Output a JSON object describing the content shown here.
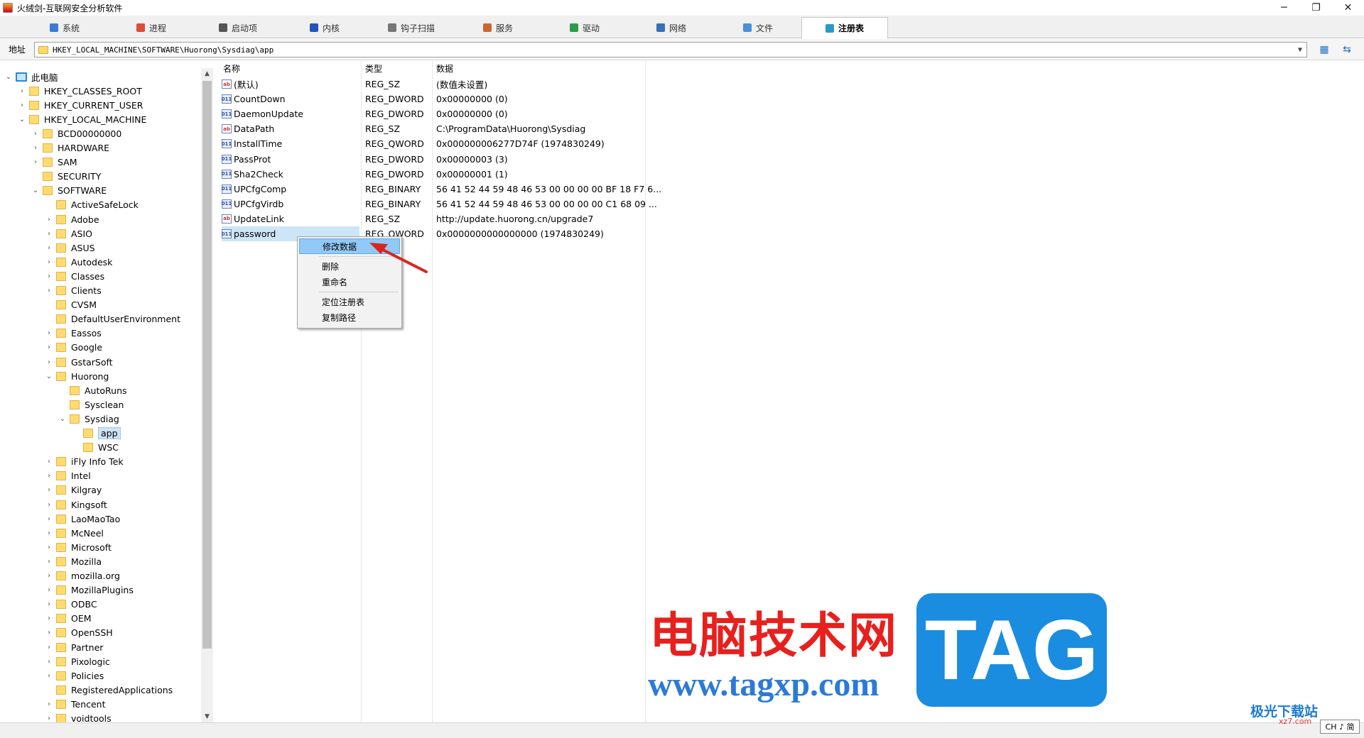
{
  "window": {
    "title": "火绒剑-互联网安全分析软件",
    "minimize": "─",
    "maximize": "❐",
    "close": "✕"
  },
  "tabs": [
    {
      "label": "系统",
      "color": "#3a7bd5"
    },
    {
      "label": "进程",
      "color": "#e04b3a"
    },
    {
      "label": "启动项",
      "color": "#555555"
    },
    {
      "label": "内核",
      "color": "#2255bb"
    },
    {
      "label": "钩子扫描",
      "color": "#777777"
    },
    {
      "label": "服务",
      "color": "#cc6633"
    },
    {
      "label": "驱动",
      "color": "#2a9d4a"
    },
    {
      "label": "网络",
      "color": "#3a6fb5"
    },
    {
      "label": "文件",
      "color": "#4a90d9"
    },
    {
      "label": "注册表",
      "color": "#2b9ac9"
    }
  ],
  "active_tab": "注册表",
  "address": {
    "label": "地址",
    "value": "HKEY_LOCAL_MACHINE\\SOFTWARE\\Huorong\\Sysdiag\\app"
  },
  "tree": {
    "root": "此电脑",
    "items": [
      {
        "label": "HKEY_CLASSES_ROOT",
        "level": 1,
        "twisty": ">"
      },
      {
        "label": "HKEY_CURRENT_USER",
        "level": 1,
        "twisty": ">"
      },
      {
        "label": "HKEY_LOCAL_MACHINE",
        "level": 1,
        "twisty": "v"
      },
      {
        "label": "BCD00000000",
        "level": 2,
        "twisty": ">"
      },
      {
        "label": "HARDWARE",
        "level": 2,
        "twisty": ">"
      },
      {
        "label": "SAM",
        "level": 2,
        "twisty": ">"
      },
      {
        "label": "SECURITY",
        "level": 2,
        "twisty": ""
      },
      {
        "label": "SOFTWARE",
        "level": 2,
        "twisty": "v"
      },
      {
        "label": "ActiveSafeLock",
        "level": 3,
        "twisty": ""
      },
      {
        "label": "Adobe",
        "level": 3,
        "twisty": ">"
      },
      {
        "label": "ASIO",
        "level": 3,
        "twisty": ">"
      },
      {
        "label": "ASUS",
        "level": 3,
        "twisty": ">"
      },
      {
        "label": "Autodesk",
        "level": 3,
        "twisty": ">"
      },
      {
        "label": "Classes",
        "level": 3,
        "twisty": ">"
      },
      {
        "label": "Clients",
        "level": 3,
        "twisty": ">"
      },
      {
        "label": "CVSM",
        "level": 3,
        "twisty": ""
      },
      {
        "label": "DefaultUserEnvironment",
        "level": 3,
        "twisty": ""
      },
      {
        "label": "Eassos",
        "level": 3,
        "twisty": ">"
      },
      {
        "label": "Google",
        "level": 3,
        "twisty": ">"
      },
      {
        "label": "GstarSoft",
        "level": 3,
        "twisty": ">"
      },
      {
        "label": "Huorong",
        "level": 3,
        "twisty": "v"
      },
      {
        "label": "AutoRuns",
        "level": 4,
        "twisty": ""
      },
      {
        "label": "Sysclean",
        "level": 4,
        "twisty": ""
      },
      {
        "label": "Sysdiag",
        "level": 4,
        "twisty": "v"
      },
      {
        "label": "app",
        "level": 5,
        "twisty": "",
        "selected": true
      },
      {
        "label": "WSC",
        "level": 5,
        "twisty": ""
      },
      {
        "label": "iFly Info Tek",
        "level": 3,
        "twisty": ">"
      },
      {
        "label": "Intel",
        "level": 3,
        "twisty": ">"
      },
      {
        "label": "Kilgray",
        "level": 3,
        "twisty": ">"
      },
      {
        "label": "Kingsoft",
        "level": 3,
        "twisty": ">"
      },
      {
        "label": "LaoMaoTao",
        "level": 3,
        "twisty": ">"
      },
      {
        "label": "McNeel",
        "level": 3,
        "twisty": ">"
      },
      {
        "label": "Microsoft",
        "level": 3,
        "twisty": ">"
      },
      {
        "label": "Mozilla",
        "level": 3,
        "twisty": ">"
      },
      {
        "label": "mozilla.org",
        "level": 3,
        "twisty": ">"
      },
      {
        "label": "MozillaPlugins",
        "level": 3,
        "twisty": ">"
      },
      {
        "label": "ODBC",
        "level": 3,
        "twisty": ">"
      },
      {
        "label": "OEM",
        "level": 3,
        "twisty": ">"
      },
      {
        "label": "OpenSSH",
        "level": 3,
        "twisty": ">"
      },
      {
        "label": "Partner",
        "level": 3,
        "twisty": ">"
      },
      {
        "label": "Pixologic",
        "level": 3,
        "twisty": ">"
      },
      {
        "label": "Policies",
        "level": 3,
        "twisty": ">"
      },
      {
        "label": "RegisteredApplications",
        "level": 3,
        "twisty": ""
      },
      {
        "label": "Tencent",
        "level": 3,
        "twisty": ">"
      },
      {
        "label": "voidtools",
        "level": 3,
        "twisty": ">"
      }
    ]
  },
  "list": {
    "columns": [
      "名称",
      "类型",
      "数据"
    ],
    "rows": [
      {
        "name": "(默认)",
        "type": "REG_SZ",
        "data": "(数值未设置)",
        "icon": "string-value-icon"
      },
      {
        "name": "CountDown",
        "type": "REG_DWORD",
        "data": "0x00000000 (0)",
        "icon": "binary-value-icon"
      },
      {
        "name": "DaemonUpdate",
        "type": "REG_DWORD",
        "data": "0x00000000 (0)",
        "icon": "binary-value-icon"
      },
      {
        "name": "DataPath",
        "type": "REG_SZ",
        "data": "C:\\ProgramData\\Huorong\\Sysdiag",
        "icon": "string-value-icon"
      },
      {
        "name": "InstallTime",
        "type": "REG_QWORD",
        "data": "0x000000006277D74F (1974830249)",
        "icon": "binary-value-icon"
      },
      {
        "name": "PassProt",
        "type": "REG_DWORD",
        "data": "0x00000003 (3)",
        "icon": "binary-value-icon"
      },
      {
        "name": "Sha2Check",
        "type": "REG_DWORD",
        "data": "0x00000001 (1)",
        "icon": "binary-value-icon"
      },
      {
        "name": "UPCfgComp",
        "type": "REG_BINARY",
        "data": "56 41 52 44 59 48 46 53 00 00 00 00 BF 18 F7 6...",
        "icon": "binary-value-icon"
      },
      {
        "name": "UPCfgVirdb",
        "type": "REG_BINARY",
        "data": "56 41 52 44 59 48 46 53 00 00 00 00 C1 68 09 ...",
        "icon": "binary-value-icon"
      },
      {
        "name": "UpdateLink",
        "type": "REG_SZ",
        "data": "http://update.huorong.cn/upgrade7",
        "icon": "string-value-icon"
      },
      {
        "name": "password",
        "type": "REG_QWORD",
        "data": "0x0000000000000000 (1974830249)",
        "icon": "binary-value-icon",
        "selected": true
      }
    ]
  },
  "context_menu": {
    "items": [
      "修改数据",
      "删除",
      "重命名",
      "定位注册表",
      "复制路径"
    ],
    "highlighted": "修改数据"
  },
  "watermark": {
    "site_cn": "电脑技术网",
    "site_url": "www.tagxp.com",
    "tag": "TAG",
    "corner": "极光下载站",
    "corner_url": "xz7.com"
  },
  "ime": "CH ♪ 简"
}
